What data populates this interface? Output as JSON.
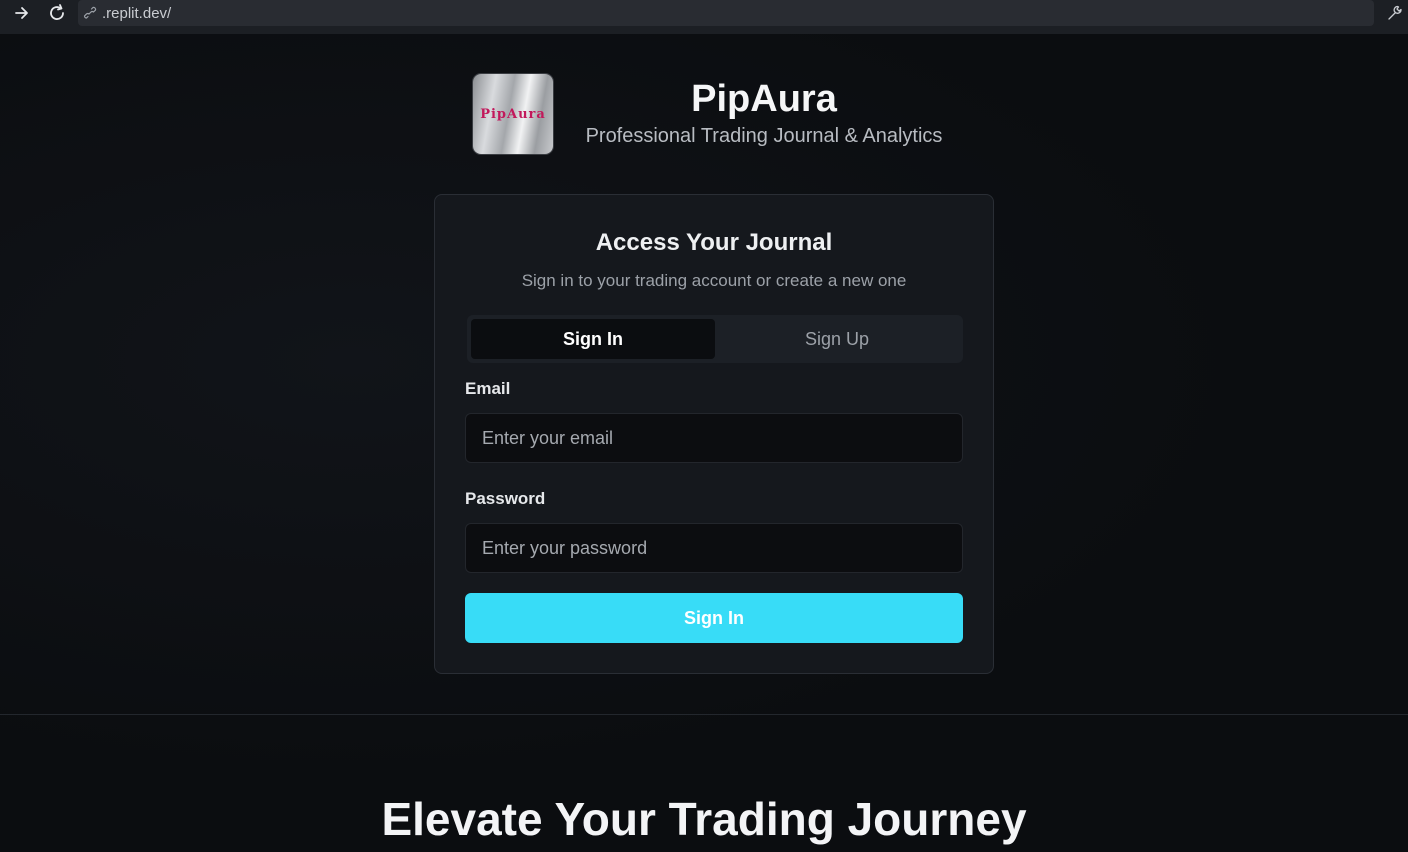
{
  "browser": {
    "url": ".replit.dev/",
    "icons": [
      "arrow-right-icon",
      "reload-icon",
      "link-icon",
      "wrench-icon"
    ]
  },
  "brand": {
    "logo_text": "PipAura",
    "title": "PipAura",
    "subtitle": "Professional Trading Journal & Analytics"
  },
  "auth_card": {
    "title": "Access Your Journal",
    "subtitle": "Sign in to your trading account or create a new one",
    "tabs": [
      {
        "label": "Sign In",
        "active": true
      },
      {
        "label": "Sign Up",
        "active": false
      }
    ],
    "email": {
      "label": "Email",
      "placeholder": "Enter your email",
      "value": ""
    },
    "password": {
      "label": "Password",
      "placeholder": "Enter your password",
      "value": ""
    },
    "submit_label": "Sign In"
  },
  "hero": {
    "title": "Elevate Your Trading Journey"
  },
  "colors": {
    "accent": "#38dcf7",
    "background": "#0b0d10",
    "card": "#15181d",
    "logo_text": "#c2185b"
  }
}
